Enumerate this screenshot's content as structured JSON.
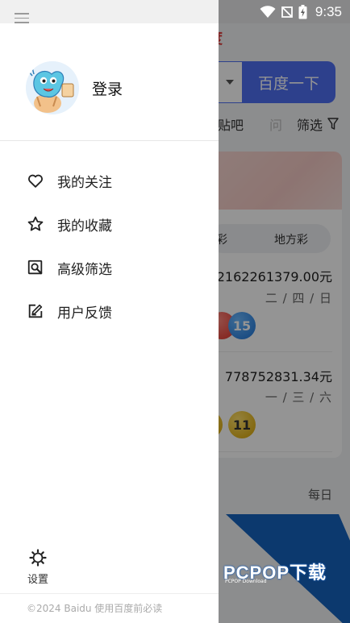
{
  "status_bar": {
    "time": "9:35",
    "icons": [
      "wifi-icon",
      "no-sim-icon",
      "battery-charging-icon"
    ]
  },
  "background_app": {
    "logo_fragment": "度",
    "search_button": "百度一下",
    "tabs": {
      "tieba": "贴吧",
      "wen": "问",
      "filter": "筛选"
    },
    "lottery_tabs": {
      "left": "彩",
      "right": "地方彩"
    },
    "draws": [
      {
        "amount": "2162261379.00元",
        "days": "二 / 四 / 日",
        "balls": [
          "",
          "15"
        ]
      },
      {
        "amount": "：778752831.34元",
        "days": "一 / 三 / 六",
        "balls": [
          "",
          "11"
        ]
      }
    ],
    "daily": "每日",
    "watermark": {
      "brand": "PCPOP下载",
      "sub": "PCPOP Download"
    }
  },
  "drawer": {
    "login_label": "登录",
    "menu": [
      {
        "label": "我的关注",
        "icon": "heart-icon"
      },
      {
        "label": "我的收藏",
        "icon": "star-icon"
      },
      {
        "label": "高级筛选",
        "icon": "search-filter-icon"
      },
      {
        "label": "用户反馈",
        "icon": "feedback-edit-icon"
      }
    ],
    "settings_label": "设置",
    "footer": "©2024 Baidu 使用百度前必读"
  },
  "colors": {
    "accent": "#4e6ef2",
    "overlay": "rgba(0,0,0,0.42)",
    "footer_text": "#aaaaaa"
  }
}
